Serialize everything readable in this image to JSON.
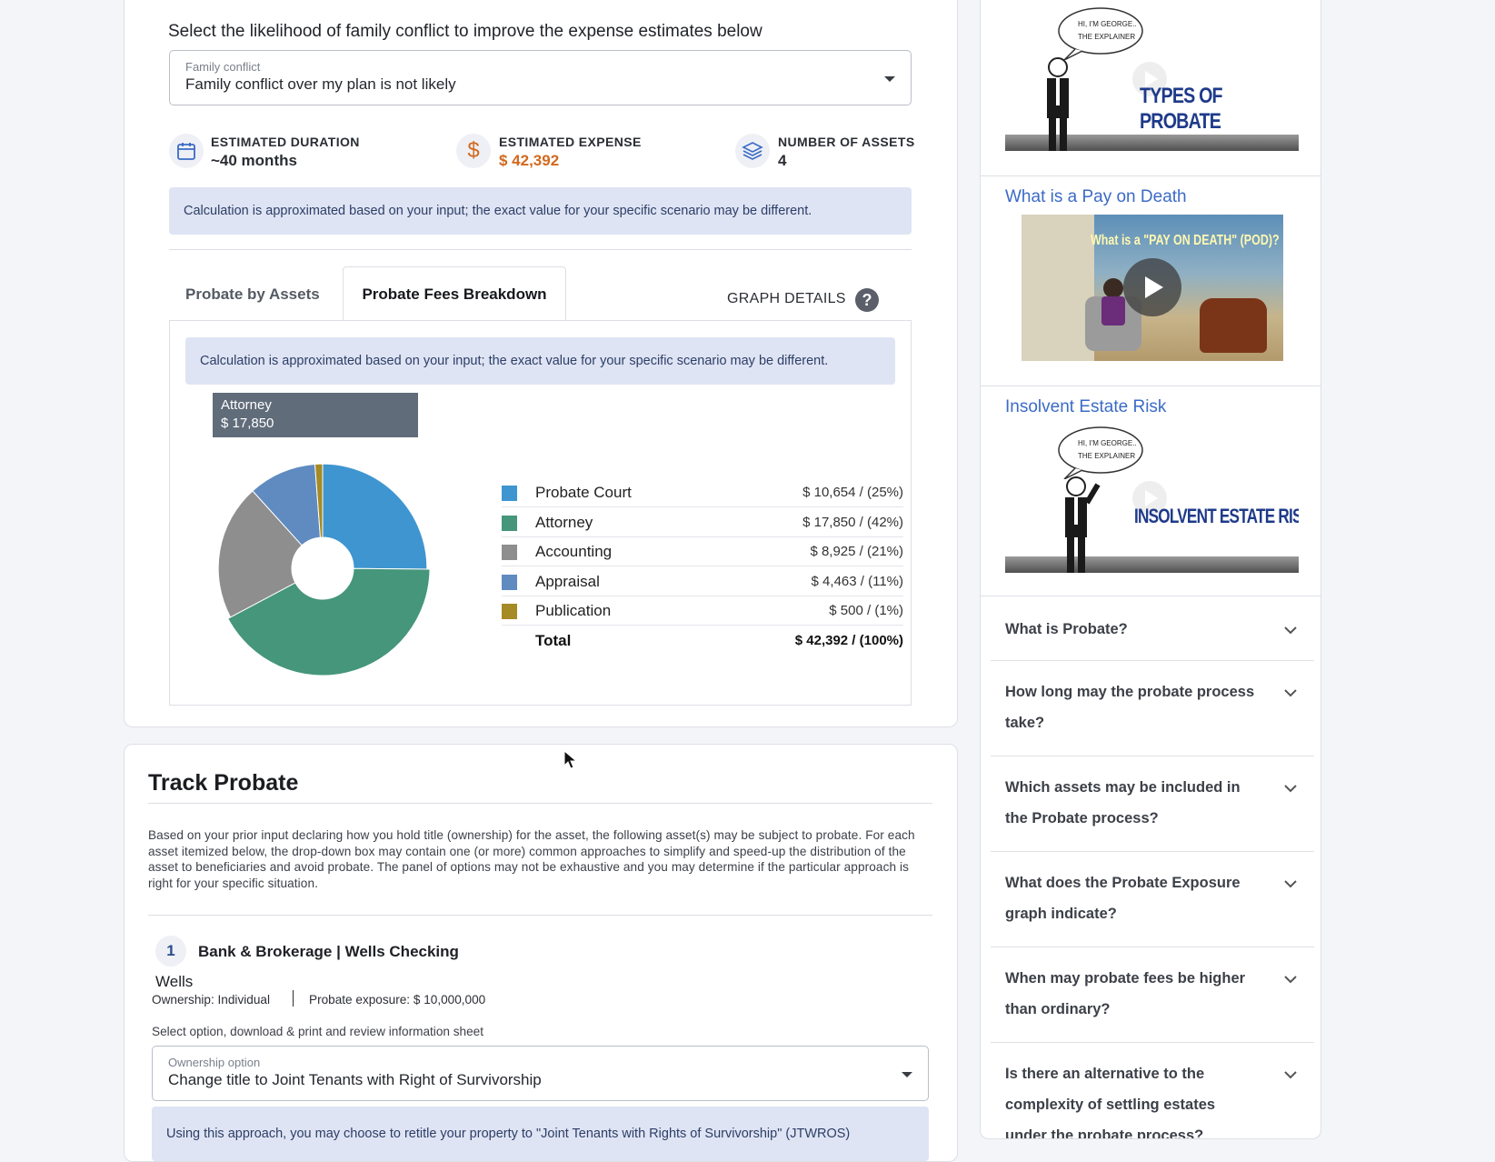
{
  "conflict": {
    "heading": "Select the likelihood of family conflict to improve the expense estimates below",
    "select_label": "Family conflict",
    "select_value": "Family conflict over my plan is not likely"
  },
  "stats": [
    {
      "icon": "calendar-icon",
      "label": "ESTIMATED DURATION",
      "value": "~40 months"
    },
    {
      "icon": "dollar-icon",
      "label": "ESTIMATED EXPENSE",
      "value": "$ 42,392"
    },
    {
      "icon": "layers-icon",
      "label": "NUMBER OF ASSETS",
      "value": "4"
    }
  ],
  "info_note": "Calculation is approximated based on your input; the exact value for your specific scenario may be different.",
  "tabs": {
    "by_assets": "Probate by Assets",
    "fees_breakdown": "Probate Fees Breakdown",
    "graph_details": "GRAPH DETAILS",
    "help_glyph": "?"
  },
  "tooltip": {
    "name": "Attorney",
    "value": "$ 17,850"
  },
  "chart_data": {
    "type": "pie",
    "donut": true,
    "categories": [
      "Probate Court",
      "Attorney",
      "Accounting",
      "Appraisal",
      "Publication"
    ],
    "values": [
      10654,
      17850,
      8925,
      4463,
      500
    ],
    "colors": [
      "#3f95d0",
      "#45967a",
      "#8e8e8e",
      "#5f8bc0",
      "#a58a26"
    ],
    "legend": [
      {
        "name": "Probate Court",
        "value": "$ 10,654 / (25%)",
        "color": "#3f95d0"
      },
      {
        "name": "Attorney",
        "value": "$ 17,850 / (42%)",
        "color": "#45967a"
      },
      {
        "name": "Accounting",
        "value": "$ 8,925 / (21%)",
        "color": "#8e8e8e"
      },
      {
        "name": "Appraisal",
        "value": "$ 4,463 / (11%)",
        "color": "#5f8bc0"
      },
      {
        "name": "Publication",
        "value": "$ 500 / (1%)",
        "color": "#a58a26"
      }
    ],
    "total": {
      "name": "Total",
      "value": "$ 42,392 / (100%)"
    },
    "highlighted": "Attorney",
    "legend_position": "right"
  },
  "track": {
    "title": "Track Probate",
    "description": "Based on your prior input declaring how you hold title (ownership) for the asset, the following asset(s) may be subject to probate. For each asset itemized below, the drop-down box may contain one (or more) common approaches to simplify and speed-up the distribution of the asset to beneficiaries and avoid probate. The panel of options may not be exhaustive and you may determine if the particular approach is right for your specific situation.",
    "asset": {
      "number": "1",
      "title": "Bank & Brokerage | Wells Checking",
      "institution": "Wells",
      "ownership": "Ownership: Individual",
      "exposure": "Probate exposure: $ 10,000,000"
    },
    "select_prompt": "Select option, download & print and review information sheet",
    "option_label": "Ownership option",
    "option_value": "Change title to Joint Tenants with Right of Survivorship",
    "approach_note": "Using this approach, you may choose to retitle your property to \"Joint Tenants with Rights of Survivorship\" (JTWROS)"
  },
  "videos": [
    {
      "title": "",
      "thumb_text": "TYPES OF PROBATE",
      "bubble_line1": "HI, I'M GEORGE..",
      "bubble_line2": "THE EXPLAINER"
    },
    {
      "title": "What is a Pay on Death",
      "thumb_text": "What is a \"PAY ON DEATH\" (POD)?"
    },
    {
      "title": "Insolvent Estate Risk",
      "thumb_text": "INSOLVENT ESTATE RISK",
      "bubble_line1": "HI, I'M GEORGE..",
      "bubble_line2": "THE EXPLAINER"
    }
  ],
  "faq": [
    {
      "line1": "What is Probate?",
      "line2": ""
    },
    {
      "line1": "How long may the probate process",
      "line2": "take?"
    },
    {
      "line1": "Which assets may be included in",
      "line2": "the Probate process?"
    },
    {
      "line1": "What does the Probate Exposure",
      "line2": "graph indicate?"
    },
    {
      "line1": "When may probate fees be higher",
      "line2": "than ordinary?"
    },
    {
      "line1": "Is there an alternative to the",
      "line2": "complexity of settling estates",
      "line3": "under the probate process?"
    }
  ]
}
